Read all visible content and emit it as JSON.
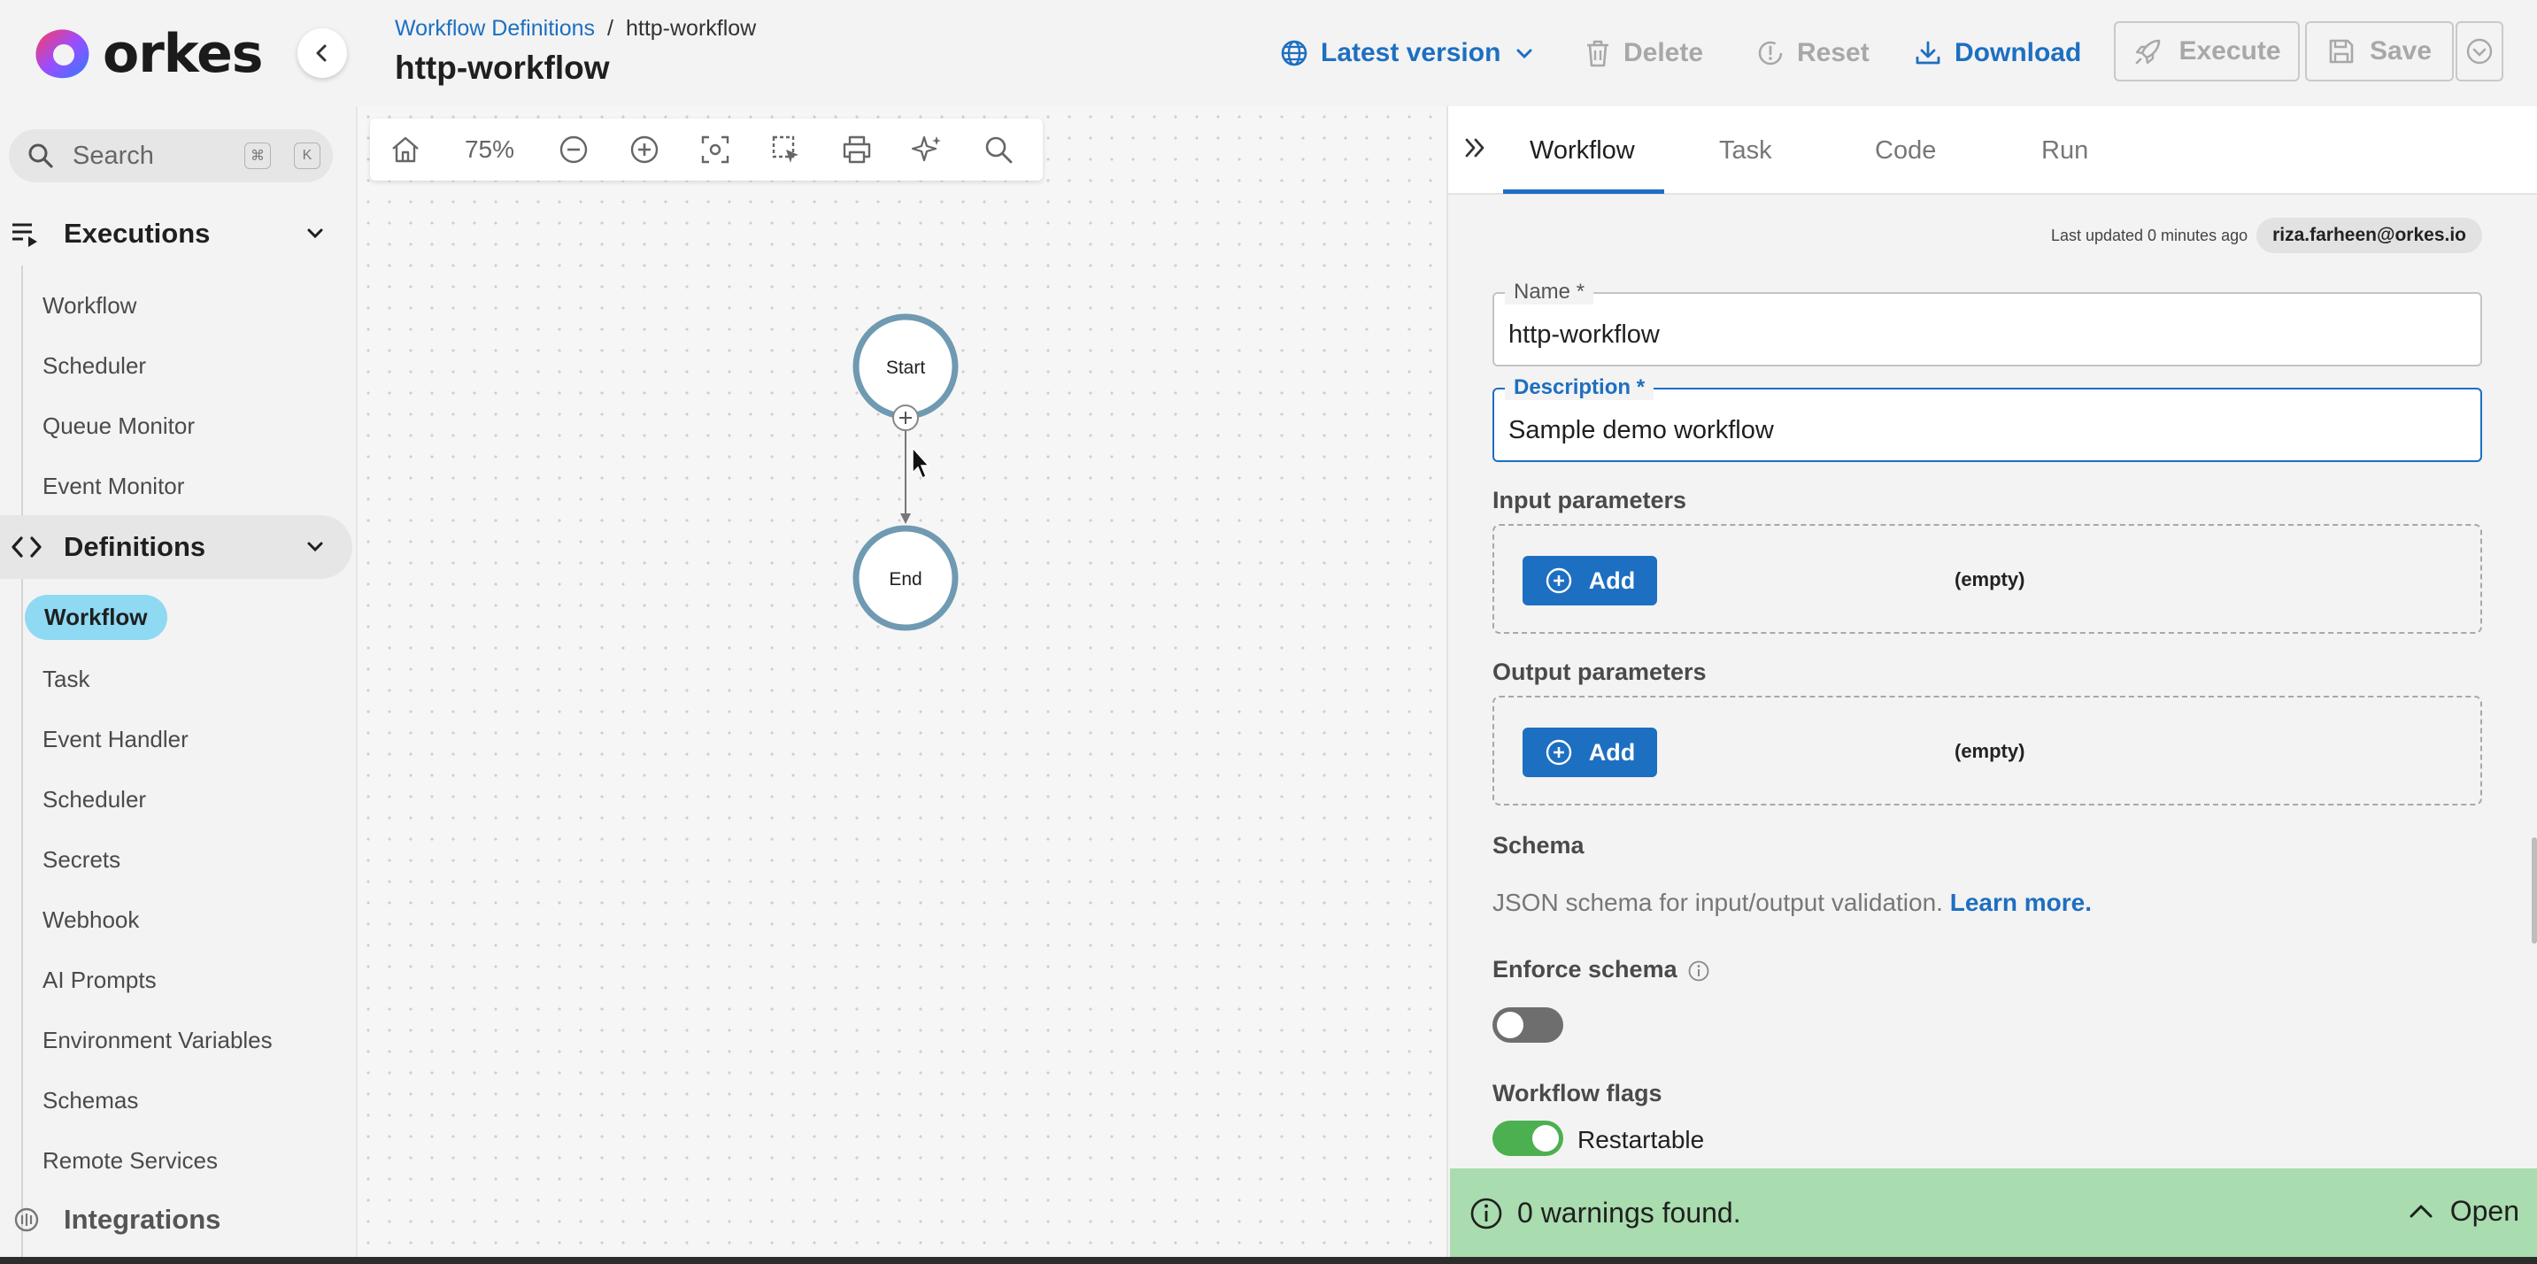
{
  "brand": {
    "name": "orkes"
  },
  "header": {
    "breadcrumb": {
      "parent": "Workflow Definitions",
      "separator": "/",
      "current": "http-workflow"
    },
    "title": "http-workflow",
    "version_label": "Latest version",
    "actions": {
      "delete": "Delete",
      "reset": "Reset",
      "download": "Download",
      "execute": "Execute",
      "save": "Save"
    }
  },
  "sidebar": {
    "search": {
      "placeholder": "Search",
      "shortcut": [
        "⌘",
        "K"
      ]
    },
    "executions": {
      "label": "Executions",
      "items": [
        "Workflow",
        "Scheduler",
        "Queue Monitor",
        "Event Monitor"
      ]
    },
    "definitions": {
      "label": "Definitions",
      "items": [
        "Workflow",
        "Task",
        "Event Handler",
        "Scheduler",
        "Secrets",
        "Webhook",
        "AI Prompts",
        "Environment Variables",
        "Schemas",
        "Remote Services"
      ],
      "selected": "Workflow"
    },
    "integrations": {
      "label": "Integrations"
    }
  },
  "canvas": {
    "zoom": "75%",
    "nodes": {
      "start": "Start",
      "end": "End"
    }
  },
  "panel": {
    "tabs": [
      "Workflow",
      "Task",
      "Code",
      "Run"
    ],
    "active_tab": "Workflow",
    "meta": {
      "last_updated": "Last updated 0 minutes ago",
      "user": "riza.farheen@orkes.io"
    },
    "name": {
      "label": "Name *",
      "value": "http-workflow"
    },
    "description": {
      "label": "Description *",
      "value": "Sample demo workflow"
    },
    "input_parameters": {
      "title": "Input parameters",
      "add_label": "Add",
      "empty_label": "(empty)"
    },
    "output_parameters": {
      "title": "Output parameters",
      "add_label": "Add",
      "empty_label": "(empty)"
    },
    "schema": {
      "title": "Schema",
      "description": "JSON schema for input/output validation.",
      "learn_more": "Learn more."
    },
    "enforce_schema": {
      "label": "Enforce schema",
      "enabled": false
    },
    "workflow_flags": {
      "title": "Workflow flags",
      "restartable_label": "Restartable",
      "restartable": true
    }
  },
  "warnings": {
    "text": "0 warnings found.",
    "open_label": "Open"
  },
  "colors": {
    "accent": "#1d6fc1",
    "selected_nav": "#8fd9f3",
    "warnings_bg": "#a9dcae",
    "toggle_on": "#4caf50",
    "node_ring": "#6f9ab1"
  }
}
